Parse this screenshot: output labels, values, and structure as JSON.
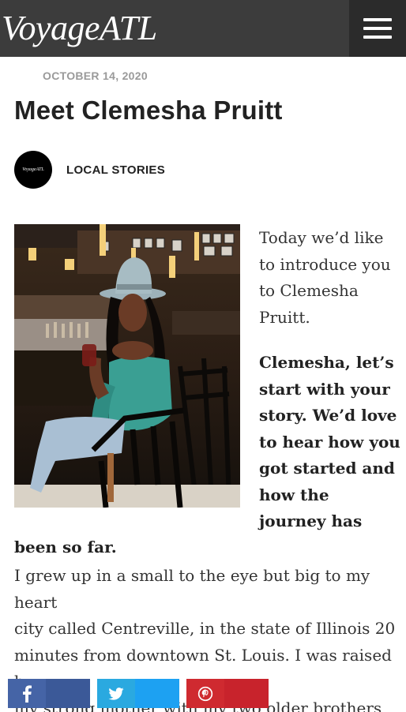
{
  "header": {
    "logo": "VoyageATL",
    "menu_icon": "hamburger-icon"
  },
  "article": {
    "date": "OCTOBER 14, 2020",
    "title": "Meet Clemesha Pruitt",
    "author_avatar_text": "VoyageATL",
    "category": "LOCAL STORIES",
    "intro_lines": [
      "Today we’d like",
      "to introduce you",
      "to Clemesha",
      "Pruitt."
    ],
    "question_lines": [
      "Clemesha, let’s",
      "start with your",
      "story. We’d love",
      "to hear how you",
      "got started and",
      "how the",
      "journey has"
    ],
    "question_tail": "been so far.",
    "answer_lines": [
      "I grew up in a small to the eye but big to my heart",
      "city called Centreville, in the state of Illinois 20",
      "minutes from downtown St. Louis. I was raised by",
      "my strong mother with my two older brothers"
    ]
  },
  "share": {
    "facebook_icon": "facebook-icon",
    "twitter_icon": "twitter-icon",
    "pinterest_icon": "pinterest-icon",
    "colors": {
      "facebook": "#3b5998",
      "twitter": "#1da1f2",
      "pinterest": "#c8232c"
    }
  }
}
